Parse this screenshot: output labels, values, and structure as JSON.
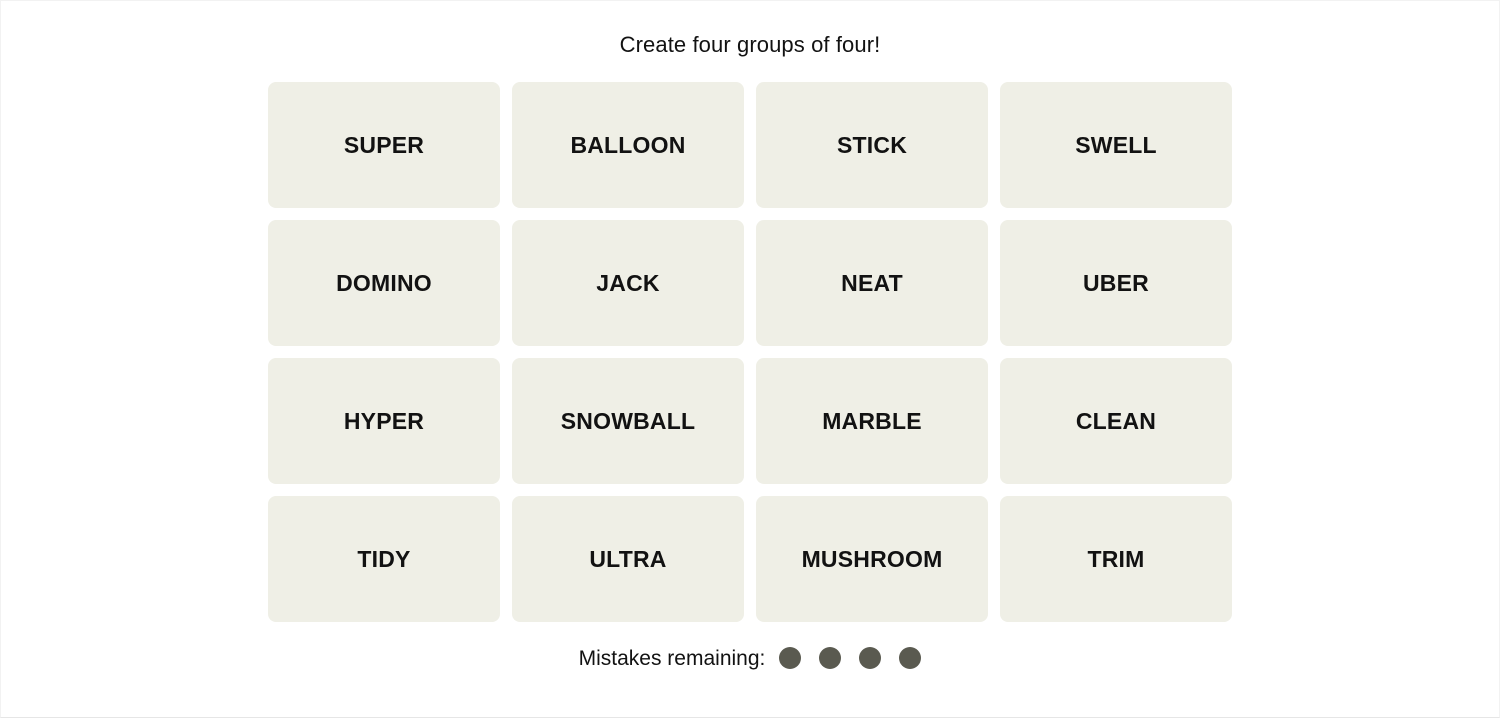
{
  "header": {
    "title": "Create four groups of four!"
  },
  "board": {
    "rows": 4,
    "columns": 4,
    "tile_background": "#EFEFE6",
    "tiles": [
      {
        "label": "SUPER"
      },
      {
        "label": "BALLOON"
      },
      {
        "label": "STICK"
      },
      {
        "label": "SWELL"
      },
      {
        "label": "DOMINO"
      },
      {
        "label": "JACK"
      },
      {
        "label": "NEAT"
      },
      {
        "label": "UBER"
      },
      {
        "label": "HYPER"
      },
      {
        "label": "SNOWBALL"
      },
      {
        "label": "MARBLE"
      },
      {
        "label": "CLEAN"
      },
      {
        "label": "TIDY"
      },
      {
        "label": "ULTRA"
      },
      {
        "label": "MUSHROOM"
      },
      {
        "label": "TRIM"
      }
    ]
  },
  "footer": {
    "mistakes_label": "Mistakes remaining:",
    "mistakes_remaining": 4,
    "dot_color": "#5A5A50",
    "dots": [
      {
        "name": "mistake-dot-1"
      },
      {
        "name": "mistake-dot-2"
      },
      {
        "name": "mistake-dot-3"
      },
      {
        "name": "mistake-dot-4"
      }
    ]
  }
}
